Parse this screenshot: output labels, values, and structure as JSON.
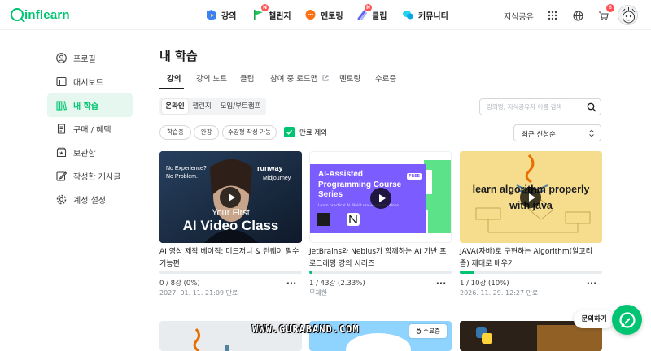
{
  "header": {
    "logo": "inflearn",
    "nav": [
      {
        "label": "강의",
        "icon": "lecture-icon"
      },
      {
        "label": "챌린지",
        "icon": "challenge-flag-icon",
        "badge": "N"
      },
      {
        "label": "멘토링",
        "icon": "mentoring-icon"
      },
      {
        "label": "클립",
        "icon": "clip-icon",
        "badge": "N"
      },
      {
        "label": "커뮤니티",
        "icon": "community-icon"
      }
    ],
    "knowledge_share": "지식공유",
    "cart_count": "8"
  },
  "sidebar": {
    "items": [
      {
        "label": "프로필",
        "icon": "profile-icon"
      },
      {
        "label": "대시보드",
        "icon": "dashboard-icon"
      },
      {
        "label": "내 학습",
        "icon": "books-icon",
        "active": true
      },
      {
        "label": "구매 / 혜택",
        "icon": "receipt-icon"
      },
      {
        "label": "보관함",
        "icon": "archive-icon"
      },
      {
        "label": "작성한 게시글",
        "icon": "edit-icon"
      },
      {
        "label": "계정 설정",
        "icon": "settings-icon"
      }
    ]
  },
  "main": {
    "title": "내 학습",
    "tabs": [
      "강의",
      "강의 노트",
      "클립",
      "참여 중 로드맵",
      "멘토링",
      "수료증"
    ],
    "segments": [
      "온라인",
      "챌린지",
      "모임/부트캠프"
    ],
    "search_placeholder": "강의명, 지식공유자 이름 검색",
    "chips": [
      "학습중",
      "완강",
      "수강평 작성 가능"
    ],
    "exclude_expired": "만료 제외",
    "sort": "최근 신청순",
    "courses": [
      {
        "title": "AI 영상 제작 베이직: 미드저니 & 런웨이 필수 기능편",
        "progress_count": "0 / 8강 (0%)",
        "progress": 0,
        "date": "2027. 01. 11. 21:09 만료",
        "thumb": {
          "line1": "No Experience?",
          "line2": "No Problem.",
          "brand1": "runway",
          "brand2": "Midjourney",
          "title1": "Your First",
          "title2": "AI Video Class"
        }
      },
      {
        "title": "JetBrains와 Nebius가 함께하는 AI 기반 프로그래밍 강의 시리즈",
        "progress_count": "1 / 43강 (2.33%)",
        "progress": 2.33,
        "date": "무제한",
        "thumb": {
          "title": "AI-Assisted Programming Course Series",
          "tag": "FREE",
          "sub": "Learn practical AI. Build real-world solutions"
        }
      },
      {
        "title": "JAVA(자바)로 구현하는 Algorithm(알고리즘) 제대로 배우기",
        "progress_count": "1 / 10강 (10%)",
        "progress": 10,
        "date": "2026. 11. 29. 12:27 만료",
        "thumb": {
          "title1": "learn algorithm properly",
          "title2": "with java"
        }
      }
    ],
    "save_badge": "수료증"
  },
  "floating": {
    "inquiry": "문의하기",
    "watermark": "WWW.GURABAND.COM"
  },
  "colors": {
    "accent": "#00c471",
    "badge": "#ff5252",
    "text": "#1b1c1d"
  }
}
